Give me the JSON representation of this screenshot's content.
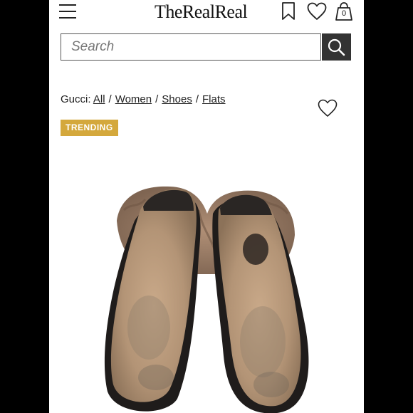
{
  "header": {
    "logo_text": "TheRealReal",
    "cart_count": "0",
    "icons": [
      "menu-icon",
      "bookmark-icon",
      "heart-icon",
      "shopping-bag-icon"
    ]
  },
  "search": {
    "placeholder": "Search",
    "button_icon": "search-icon"
  },
  "breadcrumb": {
    "brand": "Gucci:",
    "items": [
      "All",
      "Women",
      "Shoes",
      "Flats"
    ],
    "separator": "/"
  },
  "product": {
    "badge": "TRENDING",
    "favorite_icon": "heart-outline-icon",
    "image_subject": "worn fur-lined black leather slippers, soles facing up"
  },
  "colors": {
    "badge_bg": "#d4a83c",
    "search_button_bg": "#333333",
    "page_bg": "#ffffff",
    "frame_bg": "#000000"
  }
}
